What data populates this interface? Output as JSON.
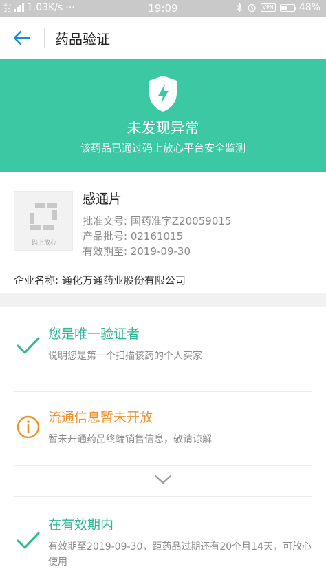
{
  "status_bar": {
    "network_type": "4G",
    "network_type2": "2G",
    "speed": "1.03K/s",
    "more": "···",
    "time": "19:09",
    "vpn": "VPN",
    "battery_percent": 48,
    "battery_label": "48%"
  },
  "header": {
    "title": "药品验证"
  },
  "banner": {
    "status_title": "未发现异常",
    "status_desc": "该药品已通过码上放心平台安全监测",
    "color": "#3cc8a2"
  },
  "product": {
    "image_label": "码上放心",
    "name": "感通片",
    "approval_no": "批准文号: 国药准字Z20059015",
    "batch_no": "产品批号: 02161015",
    "expiry": "有效期至: 2019-09-30",
    "company": "企业名称: 通化万通药业股份有限公司"
  },
  "checks": [
    {
      "icon": "check-icon",
      "title": "您是唯一验证者",
      "desc": "说明您是第一个扫描该药的个人买家",
      "color": "#2fb896"
    },
    {
      "icon": "info-icon",
      "title": "流通信息暂未开放",
      "desc": "暂未开通药品终端销售信息，敬请谅解",
      "color": "#f0902a"
    },
    {
      "icon": "check-icon",
      "title": "在有效期内",
      "desc": "有效期至2019-09-30，距药品过期还有20个月14天，可放心使用",
      "color": "#2fb896"
    }
  ],
  "expand_icon": "chevron-down-icon"
}
